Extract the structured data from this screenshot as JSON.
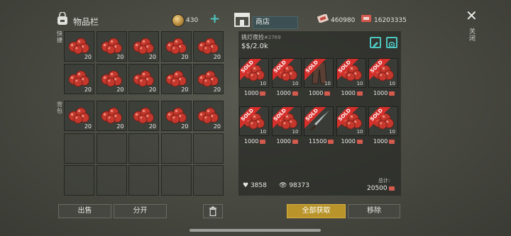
{
  "inventory": {
    "title": "物品栏",
    "currency": "430",
    "quick_label": "快捷",
    "backpack_label": "背包",
    "quick_slots": [
      {
        "item": "apple",
        "count": "20"
      },
      {
        "item": "apple",
        "count": "20"
      },
      {
        "item": "apple",
        "count": "20"
      },
      {
        "item": "apple",
        "count": "20"
      },
      {
        "item": "apple",
        "count": "20"
      },
      {
        "item": "apple",
        "count": "20"
      },
      {
        "item": "apple",
        "count": "20"
      },
      {
        "item": "apple",
        "count": "20"
      },
      {
        "item": "apple",
        "count": "20"
      },
      {
        "item": "apple",
        "count": "20"
      }
    ],
    "backpack_slots": [
      {
        "item": "apple",
        "count": "20"
      },
      {
        "item": "apple",
        "count": "20"
      },
      {
        "item": "apple",
        "count": "20"
      },
      {
        "item": "apple",
        "count": "20"
      },
      {
        "item": "apple",
        "count": "20"
      },
      {
        "item": "empty",
        "count": ""
      },
      {
        "item": "empty",
        "count": ""
      },
      {
        "item": "empty",
        "count": ""
      },
      {
        "item": "empty",
        "count": ""
      },
      {
        "item": "empty",
        "count": ""
      },
      {
        "item": "empty",
        "count": ""
      },
      {
        "item": "empty",
        "count": ""
      },
      {
        "item": "empty",
        "count": ""
      },
      {
        "item": "empty",
        "count": ""
      },
      {
        "item": "empty",
        "count": ""
      }
    ]
  },
  "shop": {
    "tab_label": "商店",
    "currency_a": "460980",
    "currency_b": "16203335",
    "close_x": "✕",
    "close_label": "关闭",
    "stall_name": "挑灯夜捡",
    "stall_id": "#2769",
    "stall_price": "$$/2.0k",
    "items": [
      {
        "item": "apple",
        "sold": "SOLD",
        "count": "10",
        "price": "1000"
      },
      {
        "item": "apple",
        "sold": "SOLD",
        "count": "10",
        "price": "1000"
      },
      {
        "item": "pants",
        "sold": "SOLD",
        "count": "10",
        "price": "1000"
      },
      {
        "item": "apple",
        "sold": "SOLD",
        "count": "10",
        "price": "1000"
      },
      {
        "item": "apple",
        "sold": "SOLD",
        "count": "10",
        "price": "1000"
      },
      {
        "item": "apple",
        "sold": "SOLD",
        "count": "10",
        "price": "1000"
      },
      {
        "item": "apple",
        "sold": "SOLD",
        "count": "10",
        "price": "1000"
      },
      {
        "item": "machete",
        "sold": "SOLD",
        "count": "",
        "price": "11500"
      },
      {
        "item": "apple",
        "sold": "SOLD",
        "count": "10",
        "price": "1000"
      },
      {
        "item": "apple",
        "sold": "SOLD",
        "count": "10",
        "price": "1000"
      }
    ],
    "likes": "3858",
    "views": "98373",
    "total_label": "总计:",
    "total_value": "20500"
  },
  "buttons": {
    "sell": "出售",
    "split": "分开",
    "take_all": "全部获取",
    "remove": "移除"
  },
  "colors": {
    "accent_teal": "#4ec6c0",
    "primary_gold": "#b8942a",
    "sold_red": "#d6302c"
  }
}
